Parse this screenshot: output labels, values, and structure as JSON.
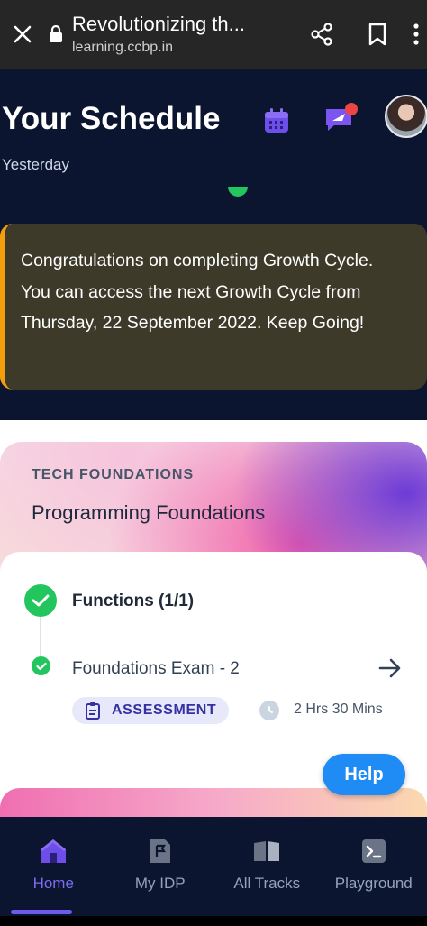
{
  "browser": {
    "title": "Revolutionizing th...",
    "url": "learning.ccbp.in",
    "icons": [
      "close-icon",
      "lock-icon",
      "share-icon",
      "bookmark-icon",
      "more-vertical-icon"
    ]
  },
  "schedule": {
    "title": "Your Schedule",
    "subtitle": "Yesterday",
    "notification_dot_color": "#ef4444",
    "congrats_message": "Congratulations on completing Growth Cycle. You can access the next Growth Cycle from Thursday, 22 September 2022. Keep Going!"
  },
  "course": {
    "tag": "TECH FOUNDATIONS",
    "name": "Programming Foundations",
    "module_title": "Functions (1/1)",
    "item_title": "Foundations Exam - 2",
    "badge_label": "ASSESSMENT",
    "duration": "2 Hrs 30 Mins",
    "status_color": "#22c55e"
  },
  "help_label": "Help",
  "nav": {
    "items": [
      {
        "label": "Home",
        "icon": "home-icon",
        "active": true
      },
      {
        "label": "My IDP",
        "icon": "idp-icon",
        "active": false
      },
      {
        "label": "All Tracks",
        "icon": "book-icon",
        "active": false
      },
      {
        "label": "Playground",
        "icon": "terminal-icon",
        "active": false
      }
    ],
    "active_color": "#7c6cf2"
  }
}
